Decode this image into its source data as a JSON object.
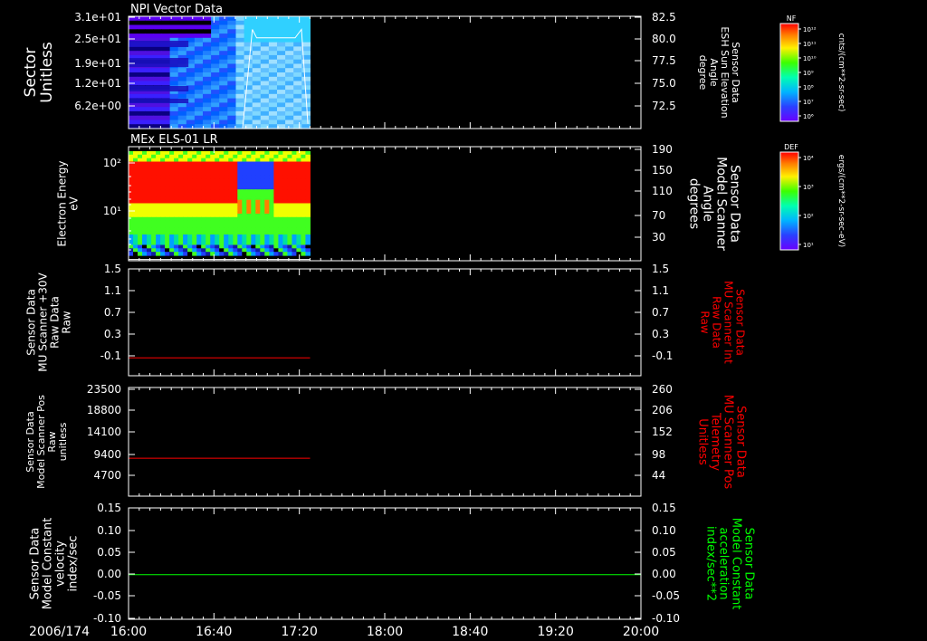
{
  "date_label": "2006/174",
  "time_ticks": [
    "16:00",
    "16:40",
    "17:20",
    "18:00",
    "18:40",
    "19:20",
    "20:00"
  ],
  "data_end_time": "17:25",
  "colorbars": [
    {
      "label": "NF",
      "unit": "cnts/(cm**2-sr-sec)",
      "ticks": [
        "10¹²",
        "10¹¹",
        "10¹⁰",
        "10⁹",
        "10⁸",
        "10⁷",
        "10⁶"
      ]
    },
    {
      "label": "DEF",
      "unit": "ergs/(cm**2-sr-sec-eV)",
      "ticks": [
        "10⁴",
        "10³",
        "10²",
        "10¹"
      ]
    }
  ],
  "panels": [
    {
      "title": "NPI Vector Data",
      "left_label": [
        "Sector",
        "Unitless"
      ],
      "left_ticks": [
        "3.1e+01",
        "2.5e+01",
        "1.9e+01",
        "1.2e+01",
        "6.2e+00"
      ],
      "right_label": [
        "Sensor Data",
        "ESH Sun Elevation",
        "Angle",
        "degree"
      ],
      "right_label_color": "#ffffff",
      "right_ticks": [
        "82.5",
        "80.0",
        "77.5",
        "75.0",
        "72.5"
      ]
    },
    {
      "title": "MEx ELS-01 LR",
      "left_label": [
        "Electron Energy",
        "eV"
      ],
      "left_ticks": [
        "10²",
        "10¹"
      ],
      "right_label": [
        "Sensor Data",
        "Model Scanner",
        "Angle",
        "degrees"
      ],
      "right_label_color": "#ffffff",
      "right_ticks": [
        "190",
        "150",
        "110",
        "70",
        "30"
      ]
    },
    {
      "title": "",
      "left_label": [
        "Sensor Data",
        "MU Scanner +30V",
        "Raw Data",
        "Raw"
      ],
      "left_ticks": [
        "1.5",
        "1.1",
        "0.7",
        "0.3",
        "-0.1"
      ],
      "right_label": [
        "Sensor Data",
        "MU Scanner Int",
        "Raw Data",
        "Raw"
      ],
      "right_label_color": "#ff0000",
      "right_ticks": [
        "1.5",
        "1.1",
        "0.7",
        "0.3",
        "-0.1"
      ]
    },
    {
      "title": "",
      "left_label": [
        "Sensor Data",
        "Model Scanner Pos",
        "Raw",
        "unitless"
      ],
      "left_ticks": [
        "23500",
        "18800",
        "14100",
        "9400",
        "4700"
      ],
      "right_label": [
        "Sensor Data",
        "MU Scanner Pos",
        "Telemetry",
        "Unitless"
      ],
      "right_label_color": "#ff0000",
      "right_ticks": [
        "260",
        "206",
        "152",
        "98",
        "44"
      ]
    },
    {
      "title": "",
      "left_label": [
        "Sensor Data",
        "Model Constant",
        "velocity",
        "index/sec"
      ],
      "left_ticks": [
        "0.15",
        "0.10",
        "0.05",
        "0.00",
        "-0.05",
        "-0.10"
      ],
      "right_label": [
        "Sensor Data",
        "Model Constant",
        "acceleration",
        "index/sec**2"
      ],
      "right_label_color": "#00ff00",
      "right_ticks": [
        "0.15",
        "0.10",
        "0.05",
        "0.00",
        "-0.05",
        "-0.10"
      ]
    }
  ],
  "chart_data": [
    {
      "type": "heatmap",
      "title": "NPI Vector Data",
      "ylabel": "Sector Unitless",
      "ylim": [
        0,
        32
      ],
      "xlim": [
        "16:00",
        "20:00"
      ],
      "data_extent": [
        "16:00",
        "17:25"
      ],
      "overlay": {
        "label": "Sensor Data ESH Sun Elevation Angle degree",
        "ylim": [
          70.5,
          82.5
        ],
        "x": [
          "16:00",
          "16:55",
          "16:58",
          "17:00",
          "17:18",
          "17:21",
          "17:24",
          "17:25"
        ],
        "y": [
          null,
          null,
          81.1,
          80.2,
          80.2,
          81.1,
          71.0,
          null
        ]
      }
    },
    {
      "type": "heatmap",
      "title": "MEx ELS-01 LR",
      "ylabel": "Electron Energy eV",
      "log_y": true,
      "ylim": [
        1,
        200
      ],
      "xlim": [
        "16:00",
        "20:00"
      ],
      "data_extent": [
        "16:00",
        "17:25"
      ],
      "overlay": {
        "label": "Sensor Data Model Scanner Angle degrees",
        "ylim": [
          10,
          190
        ],
        "x": [
          "16:00",
          "17:25"
        ],
        "y": [
          12,
          12
        ]
      }
    },
    {
      "type": "line",
      "ylim": [
        -0.3,
        1.5
      ],
      "series": [
        {
          "name": "Sensor Data MU Scanner +30V Raw Data Raw",
          "color": "#ff0000",
          "x": [
            "16:00",
            "17:25"
          ],
          "y": [
            0.0,
            0.0
          ]
        }
      ]
    },
    {
      "type": "line",
      "ylim": [
        0,
        23500
      ],
      "series": [
        {
          "name": "Sensor Data Model Scanner Pos Raw unitless",
          "color": "#ff0000",
          "x": [
            "16:00",
            "17:25"
          ],
          "y": [
            8200,
            8200
          ]
        }
      ]
    },
    {
      "type": "line",
      "ylim": [
        -0.1,
        0.15
      ],
      "series": [
        {
          "name": "Sensor Data Model Constant velocity index/sec",
          "color": "#00ff00",
          "x": [
            "16:00",
            "20:00"
          ],
          "y": [
            0.0,
            0.0
          ]
        }
      ]
    }
  ]
}
